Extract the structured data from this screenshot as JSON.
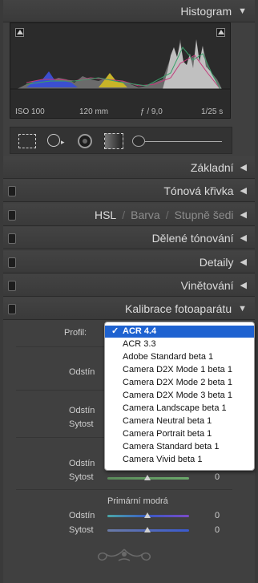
{
  "histogram": {
    "title": "Histogram",
    "iso": "ISO 100",
    "focal": "120 mm",
    "aperture": "ƒ / 9,0",
    "shutter": "1/25 s"
  },
  "sections": {
    "zakladni": "Základní",
    "tonova": "Tónová křivka",
    "hsl": "HSL",
    "barva": "Barva",
    "stupne": "Stupně šedi",
    "deleni": "Dělené tónování",
    "detaily": "Detaily",
    "vinetovani": "Vinětování",
    "kalibrace": "Kalibrace fotoaparátu"
  },
  "calibration": {
    "profil_label": "Profil:",
    "rows": [
      {
        "label": "Odstín",
        "value": "0"
      },
      {
        "label": "Odstín",
        "value": "0"
      },
      {
        "label": "Sytost",
        "value": "0"
      },
      {
        "label": "Odstín",
        "value": "0"
      },
      {
        "label": "Sytost",
        "value": "0"
      }
    ],
    "blue_title": "Primární modrá",
    "blue_rows": [
      {
        "label": "Odstín",
        "value": "0"
      },
      {
        "label": "Sytost",
        "value": "0"
      }
    ]
  },
  "profile_dropdown": {
    "selected": "ACR 4.4",
    "options": [
      "ACR 4.4",
      "ACR 3.3",
      "Adobe Standard beta 1",
      "Camera D2X Mode 1 beta 1",
      "Camera D2X Mode 2 beta 1",
      "Camera D2X Mode 3 beta 1",
      "Camera Landscape beta 1",
      "Camera Neutral beta 1",
      "Camera Portrait beta 1",
      "Camera Standard beta 1",
      "Camera Vivid beta 1"
    ]
  }
}
